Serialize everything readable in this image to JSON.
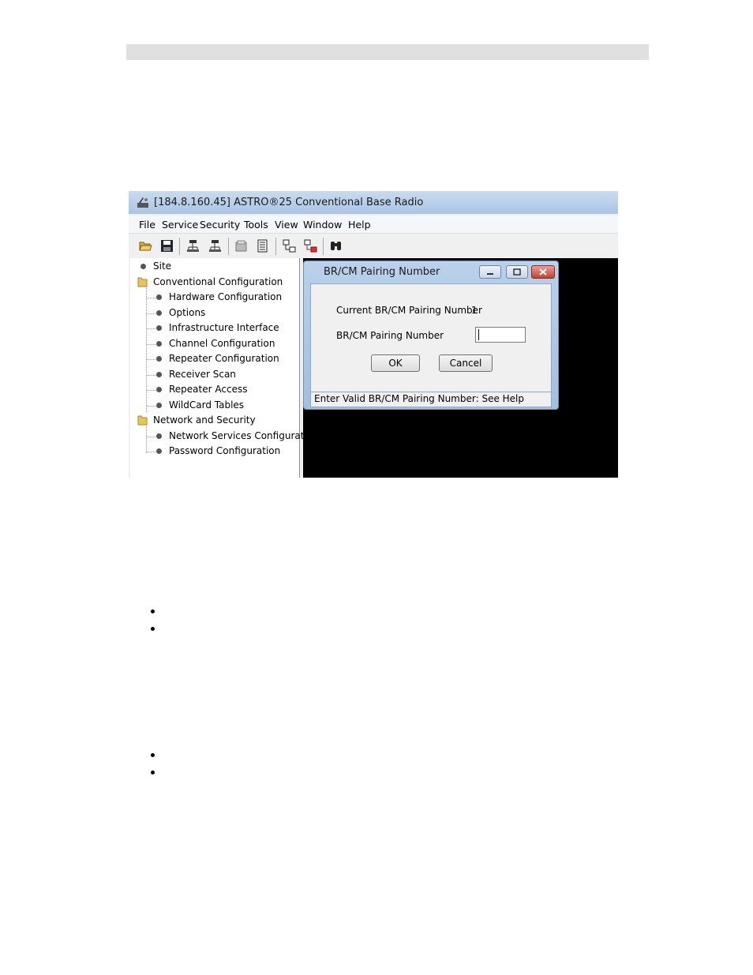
{
  "window": {
    "title": "[184.8.160.45] ASTRO®25 Conventional Base Radio"
  },
  "menu": [
    "File",
    "Service",
    "Security",
    "Tools",
    "View",
    "Window",
    "Help"
  ],
  "toolbar": {
    "icons": [
      "open-folder-icon",
      "save-icon",
      "network-read-icon",
      "network-write-icon",
      "document-icon",
      "list-icon",
      "connect-icon",
      "disconnect-icon",
      "binoculars-icon"
    ]
  },
  "tree": {
    "items": [
      {
        "label": "Site",
        "type": "leaf"
      },
      {
        "label": "Conventional Configuration",
        "type": "folder"
      },
      {
        "label": "Hardware Configuration",
        "type": "child"
      },
      {
        "label": "Options",
        "type": "child"
      },
      {
        "label": "Infrastructure Interface",
        "type": "child"
      },
      {
        "label": "Channel Configuration",
        "type": "child"
      },
      {
        "label": "Repeater Configuration",
        "type": "child"
      },
      {
        "label": "Receiver Scan",
        "type": "child"
      },
      {
        "label": "Repeater Access",
        "type": "child"
      },
      {
        "label": "WildCard Tables",
        "type": "child"
      },
      {
        "label": "Network and Security",
        "type": "folder"
      },
      {
        "label": "Network Services Configuration",
        "type": "child"
      },
      {
        "label": "Password Configuration",
        "type": "child"
      }
    ]
  },
  "dialog": {
    "title": "BR/CM Pairing Number",
    "current_label": "Current BR/CM Pairing Number",
    "current_value": "1",
    "input_label": "BR/CM Pairing Number",
    "input_value": "",
    "ok_label": "OK",
    "cancel_label": "Cancel",
    "status": "Enter Valid BR/CM Pairing Number: See Help"
  },
  "colors": {
    "titlebar": "#b4cde8",
    "background": "#000000",
    "folder": "#e8c25a"
  }
}
